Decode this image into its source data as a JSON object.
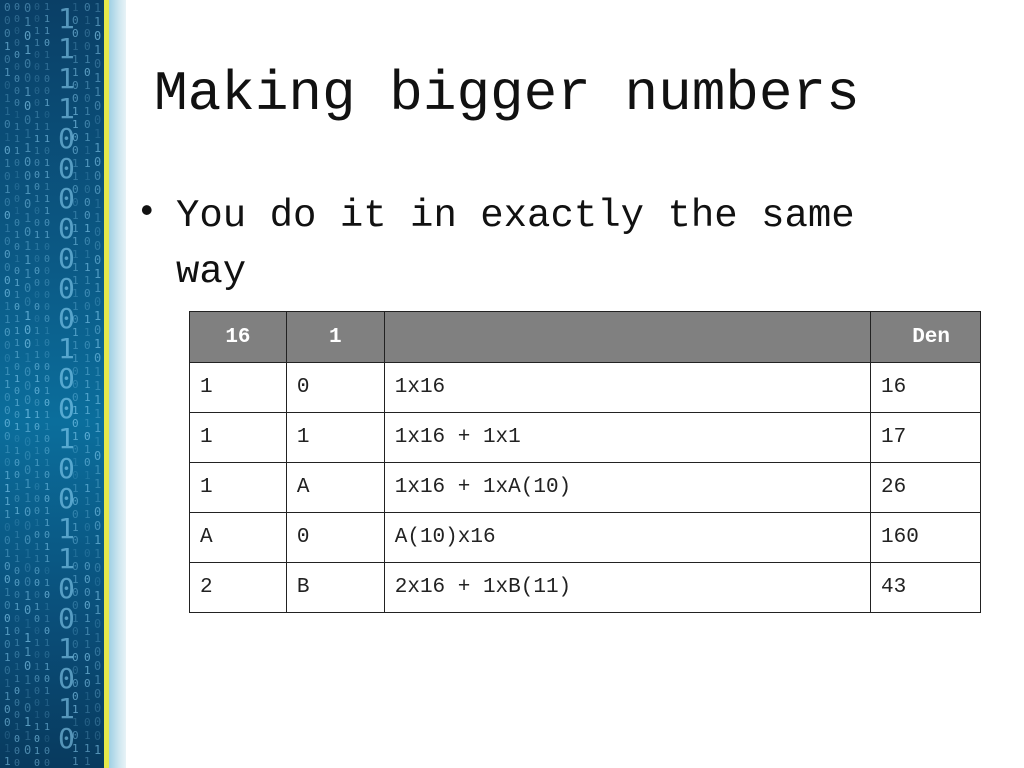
{
  "slide": {
    "title": "Making bigger numbers",
    "bullet": "You do it in exactly the same way",
    "bullet_marker": "•"
  },
  "table": {
    "headers": [
      "16",
      "1",
      "",
      "Den"
    ],
    "rows": [
      [
        "1",
        "0",
        "1x16",
        "16"
      ],
      [
        "1",
        "1",
        "1x16 + 1x1",
        "17"
      ],
      [
        "1",
        "A",
        "1x16 + 1xA(10)",
        "26"
      ],
      [
        "A",
        "0",
        "A(10)x16",
        "160"
      ],
      [
        "2",
        "B",
        "2x16 + 1xB(11)",
        "43"
      ]
    ]
  },
  "colors": {
    "header_bg": "#808080",
    "side_band": "#0b5a86",
    "accent_yellow": "#e6e84a"
  }
}
